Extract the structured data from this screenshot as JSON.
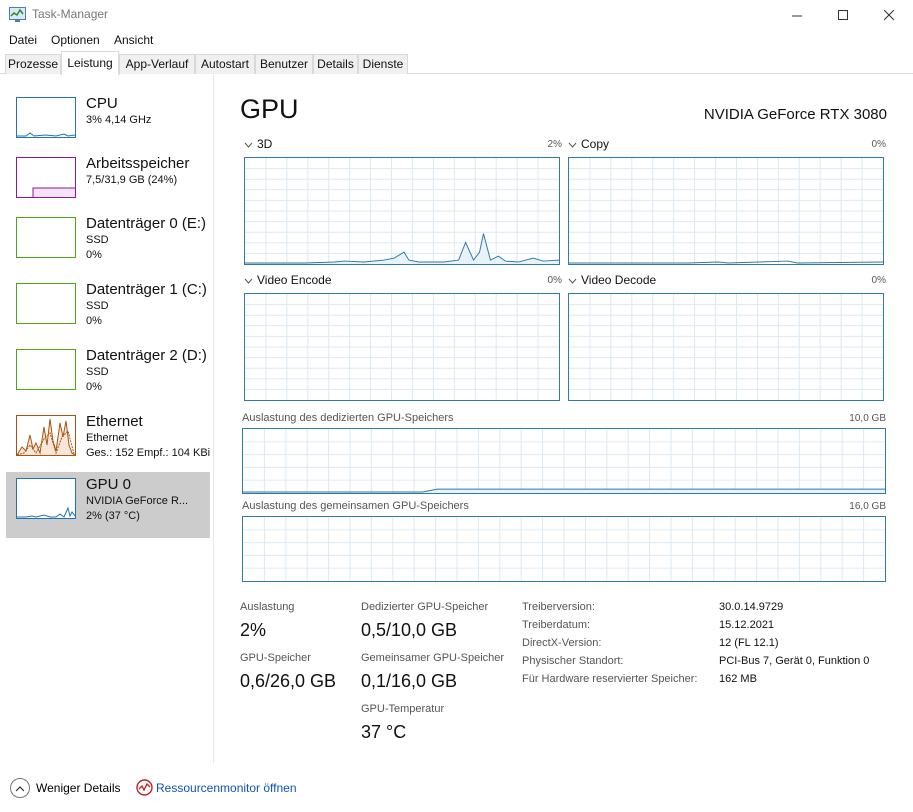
{
  "window": {
    "title": "Task-Manager",
    "controls": {
      "minimize": "—",
      "maximize": "☐",
      "close": "✕"
    }
  },
  "menu": [
    "Datei",
    "Optionen",
    "Ansicht"
  ],
  "tabs": [
    {
      "label": "Prozesse",
      "active": false
    },
    {
      "label": "Leistung",
      "active": true
    },
    {
      "label": "App-Verlauf",
      "active": false
    },
    {
      "label": "Autostart",
      "active": false
    },
    {
      "label": "Benutzer",
      "active": false
    },
    {
      "label": "Details",
      "active": false
    },
    {
      "label": "Dienste",
      "active": false
    }
  ],
  "sidebar": {
    "items": [
      {
        "name": "CPU",
        "line1": "3% 4,14 GHz",
        "line2": "",
        "color": "#1f74b3"
      },
      {
        "name": "Arbeitsspeicher",
        "line1": "7,5/31,9 GB (24%)",
        "line2": "",
        "color": "#8b179b"
      },
      {
        "name": "Datenträger 0 (E:)",
        "line1": "SSD",
        "line2": "0%",
        "color": "#4ca615"
      },
      {
        "name": "Datenträger 1 (C:)",
        "line1": "SSD",
        "line2": "0%",
        "color": "#4ca615"
      },
      {
        "name": "Datenträger 2 (D:)",
        "line1": "SSD",
        "line2": "0%",
        "color": "#4ca615"
      },
      {
        "name": "Ethernet",
        "line1": "Ethernet",
        "line2": "Ges.: 152  Empf.: 104 KBi",
        "color": "#a8530f"
      },
      {
        "name": "GPU 0",
        "line1": "NVIDIA GeForce R...",
        "line2": "2% (37 °C)",
        "color": "#1f74b3",
        "selected": true
      }
    ]
  },
  "gpu": {
    "heading": "GPU",
    "model": "NVIDIA GeForce RTX 3080",
    "engines": [
      {
        "label": "3D",
        "percent": "2%"
      },
      {
        "label": "Copy",
        "percent": "0%"
      },
      {
        "label": "Video Encode",
        "percent": "0%"
      },
      {
        "label": "Video Decode",
        "percent": "0%"
      }
    ],
    "dedicated_memory": {
      "label": "Auslastung des dedizierten GPU-Speichers",
      "capacity": "10,0 GB"
    },
    "shared_memory": {
      "label": "Auslastung des gemeinsamen GPU-Speichers",
      "capacity": "16,0 GB"
    },
    "stats": {
      "auslastung_label": "Auslastung",
      "auslastung_value": "2%",
      "gpu_speicher_label": "GPU-Speicher",
      "gpu_speicher_value": "0,6/26,0 GB",
      "dedicated_label": "Dedizierter GPU-Speicher",
      "dedicated_value": "0,5/10,0 GB",
      "shared_label": "Gemeinsamer GPU-Speicher",
      "shared_value": "0,1/16,0 GB",
      "temp_label": "GPU-Temperatur",
      "temp_value": "37 °C"
    },
    "info": [
      {
        "key": "Treiberversion:",
        "value": "30.0.14.9729"
      },
      {
        "key": "Treiberdatum:",
        "value": "15.12.2021"
      },
      {
        "key": "DirectX-Version:",
        "value": "12 (FL 12.1)"
      },
      {
        "key": "Physischer Standort:",
        "value": "PCI-Bus 7, Gerät 0, Funktion 0"
      },
      {
        "key": "Für Hardware reservierter Speicher:",
        "value": "162 MB"
      }
    ]
  },
  "footer": {
    "fewer_details": "Weniger Details",
    "resource_monitor": "Ressourcenmonitor öffnen"
  },
  "colors": {
    "gpu_line": "#2f7aa9",
    "gpu_fill": "#e9f2f8",
    "grid": "#dbe9f3",
    "selected_bg": "#cccccc",
    "link": "#0b56b3"
  }
}
